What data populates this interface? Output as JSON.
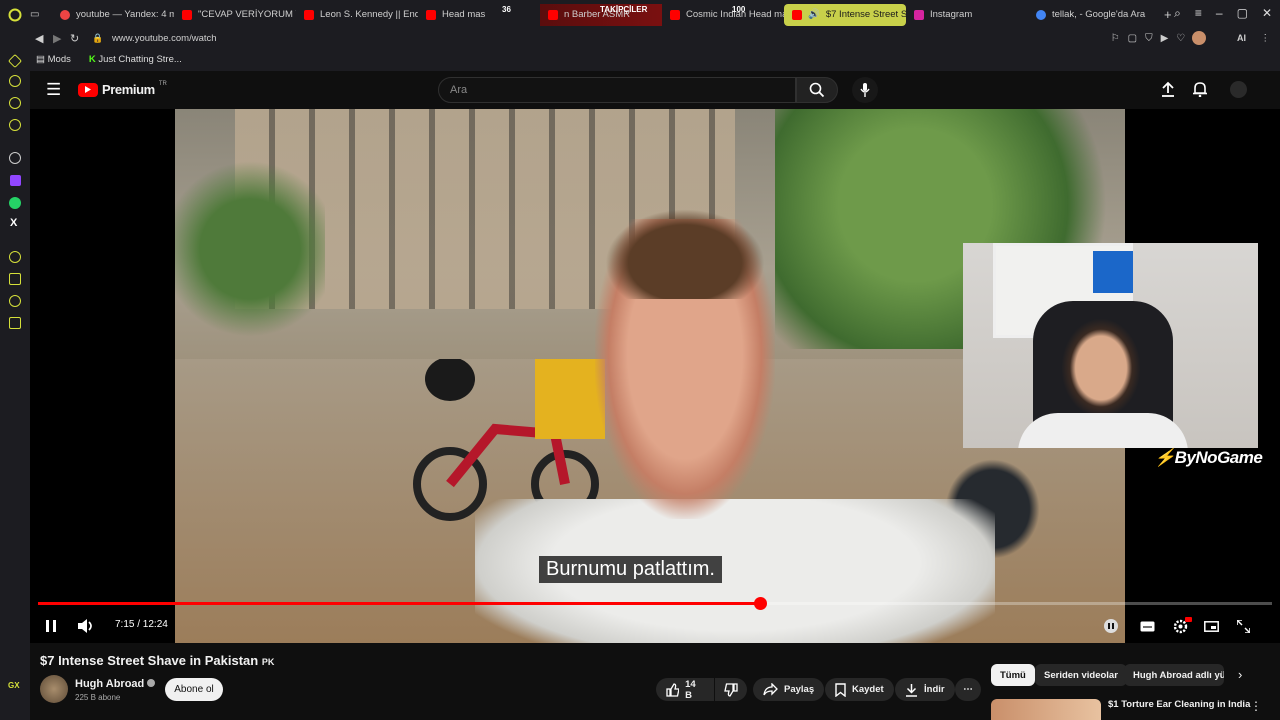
{
  "browser": {
    "tabs": [
      {
        "label": "youtube — Yandex: 4 mi",
        "color": "#e44"
      },
      {
        "label": "\"CEVAP VERİYORUM YA",
        "color": "#f00"
      },
      {
        "label": "Leon S. Kennedy || End",
        "color": "#f00"
      },
      {
        "label": "Head mas",
        "color": "#f00"
      },
      {
        "label": "n Barber ASMR",
        "color": "#f00"
      },
      {
        "label": "Cosmic Indian Head mas",
        "color": "#f00"
      },
      {
        "label": "$7 Intense Street Shav",
        "color": "#f00"
      },
      {
        "label": "Instagram",
        "color": "#d6249f"
      },
      {
        "label": "tellak, - Google'da Ara",
        "color": "#4285f4"
      }
    ],
    "stats": {
      "a": "36",
      "label": "TAKİPÇİLER",
      "b": "100"
    },
    "url": "www.youtube.com/watch",
    "bookmarks": [
      {
        "label": "Mods"
      },
      {
        "label": "Just Chatting Stre..."
      }
    ],
    "ai_label": "AI"
  },
  "youtube": {
    "logo": "Premium",
    "logo_region": "TR",
    "search_placeholder": "Ara"
  },
  "player": {
    "caption": "Burnumu patlattım.",
    "time": "7:15 / 12:24",
    "progress": 0.585,
    "overlay_brand": "ByNoGame"
  },
  "video": {
    "title": "$7 Intense Street Shave in Pakistan",
    "flag": "PK",
    "channel": "Hugh Abroad",
    "subscribers": "225 B abone",
    "subscribe_label": "Abone ol",
    "likes": "14 B",
    "share_label": "Paylaş",
    "save_label": "Kaydet",
    "download_label": "İndir"
  },
  "chips": [
    {
      "label": "Tümü"
    },
    {
      "label": "Seriden videolar"
    },
    {
      "label": "Hugh Abroad adlı yük"
    }
  ],
  "recommended": {
    "title": "$1 Torture Ear Cleaning in India"
  },
  "colors": {
    "accent": "#ff0000",
    "opera": "#d5e03a"
  }
}
